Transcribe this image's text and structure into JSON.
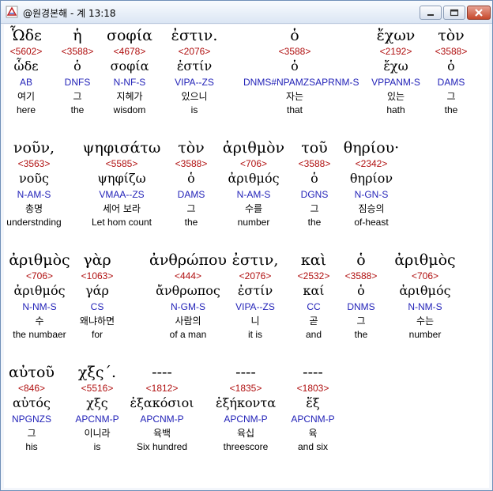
{
  "window": {
    "title": "@원경본해 - 계 13:18"
  },
  "rows": [
    [
      {
        "greek": "Ὧδε",
        "strong": "<5602>",
        "lexeme": "ὧδε",
        "parse": "AB",
        "korean": "여기",
        "english": "here"
      },
      {
        "greek": "ἡ",
        "strong": "<3588>",
        "lexeme": "ὁ",
        "parse": "DNFS",
        "korean": "그",
        "english": "the"
      },
      {
        "greek": "σοφία",
        "strong": "<4678>",
        "lexeme": "σοφία",
        "parse": "N-NF-S",
        "korean": "지혜가",
        "english": "wisdom"
      },
      {
        "greek": "ἐστιν.",
        "strong": "<2076>",
        "lexeme": "ἐστίν",
        "parse": "VIPA--ZS",
        "korean": "있으니",
        "english": "is"
      },
      {
        "greek": "ὁ",
        "strong": "<3588>",
        "lexeme": "ὁ",
        "parse": "DNMS#NPAMZSAPRNM-S",
        "korean": "자는",
        "english": "that"
      },
      {
        "greek": "ἔχων",
        "strong": "<2192>",
        "lexeme": "ἔχω",
        "parse": "VPPANM-S",
        "korean": "있는",
        "english": "hath"
      },
      {
        "greek": "τὸν",
        "strong": "<3588>",
        "lexeme": "ὁ",
        "parse": "DAMS",
        "korean": "그",
        "english": "the"
      }
    ],
    [
      {
        "greek": "νοῦν,",
        "strong": "<3563>",
        "lexeme": "νοῦς",
        "parse": "N-AM-S",
        "korean": "총명",
        "english": "understnding"
      },
      {
        "greek": "ψηφισάτω",
        "strong": "<5585>",
        "lexeme": "ψηφίζω",
        "parse": "VMAA--ZS",
        "korean": "세어 보라",
        "english": "Let hom count"
      },
      {
        "greek": "τὸν",
        "strong": "<3588>",
        "lexeme": "ὁ",
        "parse": "DAMS",
        "korean": "그",
        "english": "the"
      },
      {
        "greek": "ἀριθμὸν",
        "strong": "<706>",
        "lexeme": "ἀριθμός",
        "parse": "N-AM-S",
        "korean": "수를",
        "english": "number"
      },
      {
        "greek": "τοῦ",
        "strong": "<3588>",
        "lexeme": "ὁ",
        "parse": "DGNS",
        "korean": "그",
        "english": "the"
      },
      {
        "greek": "θηρίου·",
        "strong": "<2342>",
        "lexeme": "θηρίον",
        "parse": "N-GN-S",
        "korean": "짐승의",
        "english": "of-heast"
      }
    ],
    [
      {
        "greek": "ἀριθμὸς",
        "strong": "<706>",
        "lexeme": "ἀριθμός",
        "parse": "N-NM-S",
        "korean": "수",
        "english": "the numbaer"
      },
      {
        "greek": "γὰρ",
        "strong": "<1063>",
        "lexeme": "γάρ",
        "parse": "CS",
        "korean": "왜냐하면",
        "english": "for"
      },
      {
        "greek": "ἀνθρώπου",
        "strong": "<444>",
        "lexeme": "ἄνθρωπος",
        "parse": "N-GM-S",
        "korean": "사람의",
        "english": "of a man"
      },
      {
        "greek": "ἐστιν,",
        "strong": "<2076>",
        "lexeme": "ἐστίν",
        "parse": "VIPA--ZS",
        "korean": "니",
        "english": "it is"
      },
      {
        "greek": "καὶ",
        "strong": "<2532>",
        "lexeme": "καί",
        "parse": "CC",
        "korean": "곧",
        "english": "and"
      },
      {
        "greek": "ὁ",
        "strong": "<3588>",
        "lexeme": "ὁ",
        "parse": "DNMS",
        "korean": "그",
        "english": "the"
      },
      {
        "greek": "ἀριθμὸς",
        "strong": "<706>",
        "lexeme": "ἀριθμός",
        "parse": "N-NM-S",
        "korean": "수는",
        "english": "number"
      }
    ],
    [
      {
        "greek": "αὐτοῦ",
        "strong": "<846>",
        "lexeme": "αὐτός",
        "parse": "NPGNZS",
        "korean": "그",
        "english": "his"
      },
      {
        "greek": "χξς´.",
        "strong": "<5516>",
        "lexeme": "χξς",
        "parse": "APCNM-P",
        "korean": "이니라",
        "english": "is"
      },
      {
        "greek": "----",
        "strong": "<1812>",
        "lexeme": "ἑξακόσιοι",
        "parse": "APCNM-P",
        "korean": "육백",
        "english": "Six hundred"
      },
      {
        "greek": "----",
        "strong": "<1835>",
        "lexeme": "ἑξήκοντα",
        "parse": "APCNM-P",
        "korean": "육십",
        "english": "threescore"
      },
      {
        "greek": "----",
        "strong": "<1803>",
        "lexeme": "ἕξ",
        "parse": "APCNM-P",
        "korean": "육",
        "english": "and six"
      }
    ]
  ]
}
